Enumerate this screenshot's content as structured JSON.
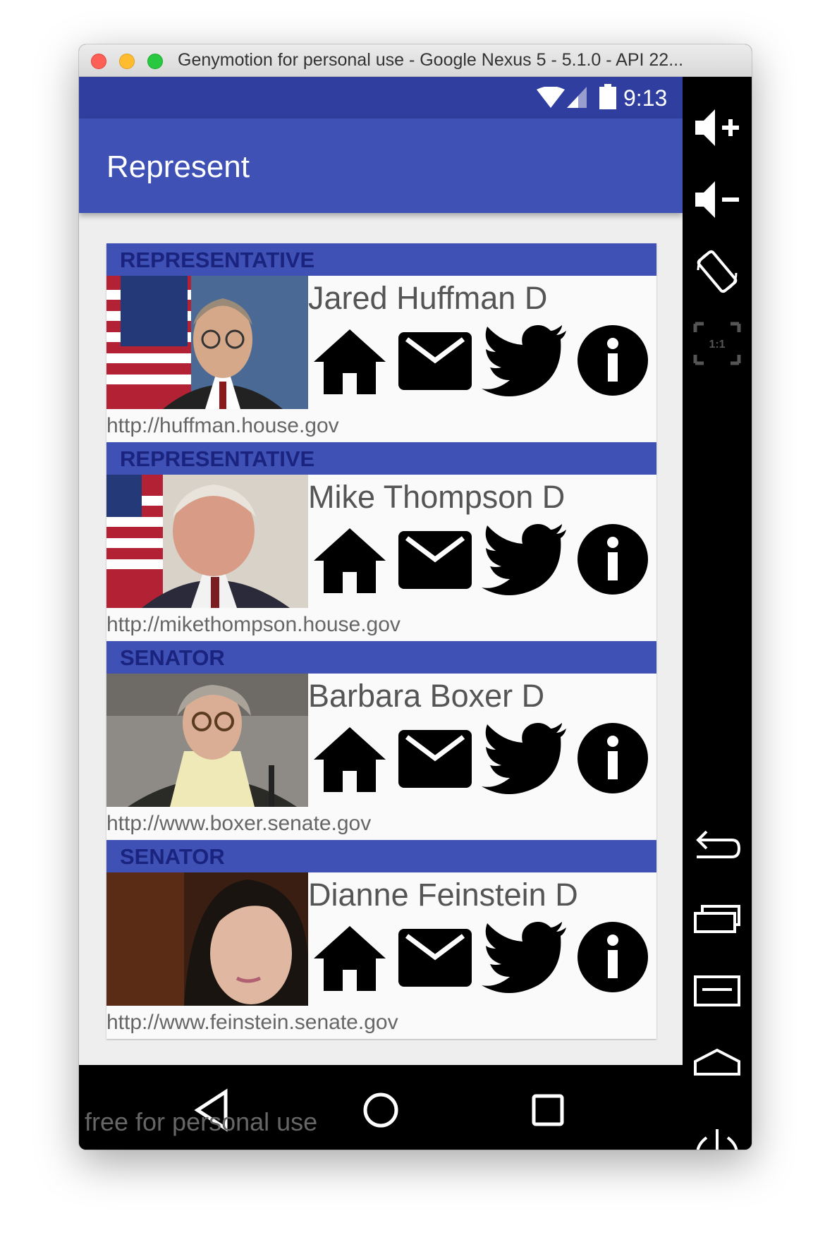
{
  "window": {
    "title": "Genymotion for personal use - Google Nexus 5 - 5.1.0 - API 22..."
  },
  "status_bar": {
    "time": "9:13"
  },
  "app_bar": {
    "title": "Represent"
  },
  "cards": [
    {
      "role": "REPRESENTATIVE",
      "name": "Jared Huffman D",
      "url": "http://huffman.house.gov"
    },
    {
      "role": "REPRESENTATIVE",
      "name": "Mike Thompson D",
      "url": "http://mikethompson.house.gov"
    },
    {
      "role": "SENATOR",
      "name": "Barbara Boxer D",
      "url": "http://www.boxer.senate.gov"
    },
    {
      "role": "SENATOR",
      "name": "Dianne Feinstein D",
      "url": "http://www.feinstein.senate.gov"
    }
  ],
  "card_icons": [
    "home-icon",
    "mail-icon",
    "twitter-icon",
    "info-icon"
  ],
  "side_panel": {
    "zoom_label": "1:1"
  },
  "watermark": "free for personal use",
  "colors": {
    "primary": "#3f51b5",
    "primary_dark": "#303f9f",
    "header_text": "#1a237e"
  }
}
